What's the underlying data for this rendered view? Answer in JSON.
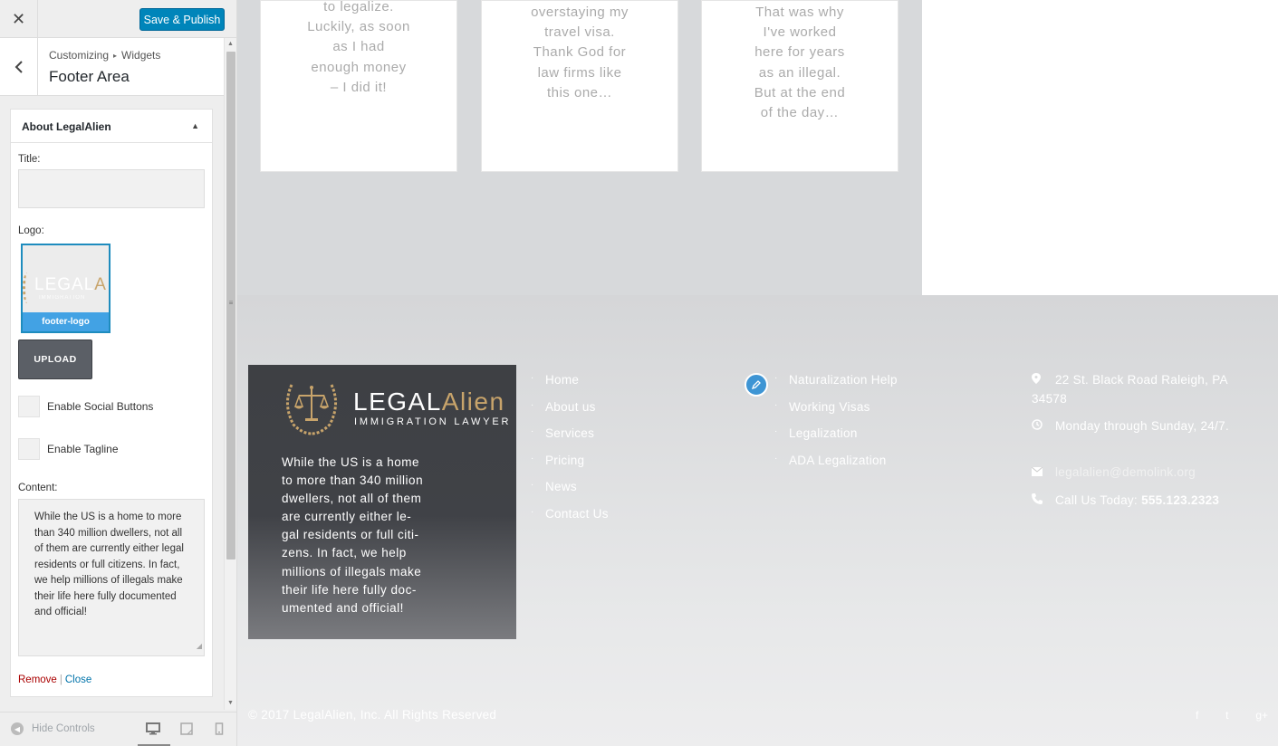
{
  "customizer": {
    "save_label": "Save & Publish",
    "breadcrumb": [
      "Customizing",
      "Widgets"
    ],
    "section_title": "Footer Area",
    "widget": {
      "title": "About LegalAlien",
      "title_label": "Title:",
      "title_value": "",
      "logo_label": "Logo:",
      "logo_thumb_brand_main": "LEGAL",
      "logo_thumb_brand_accent": "A",
      "logo_thumb_brand_sub": "IMMIGRATION",
      "logo_caption": "footer-logo",
      "upload_label": "UPLOAD",
      "social_label": "Enable Social Buttons",
      "tagline_label": "Enable Tagline",
      "content_label": "Content:",
      "content_value": "While the US is a home to more than 340 million dwellers, not all of them are currently either legal residents or full citizens. In fact, we help millions of illegals make their life here fully documented and official!",
      "remove_label": "Remove",
      "close_label": "Close",
      "separator": "|"
    },
    "hide_controls_label": "Hide Controls"
  },
  "preview": {
    "testimonial_cards": [
      {
        "lines": [
          "to legalize.",
          "Luckily, as soon",
          "as I had",
          "enough money",
          "– I did it!"
        ]
      },
      {
        "lines": [
          "overstaying my",
          "travel visa.",
          "Thank God for",
          "law firms like",
          "this one…"
        ]
      },
      {
        "lines": [
          "That was why",
          "I've worked",
          "here for years",
          "as an illegal.",
          "But at the end",
          "of the day…"
        ]
      }
    ],
    "footer_logo": {
      "main": "LEGAL",
      "accent": "Alien",
      "sub": "IMMIGRATION LAWYER"
    },
    "about_lines": [
      "While the US is a home",
      "to more than 340 million",
      "dwellers, not all of them",
      "are currently either le-",
      "gal residents or full citi-",
      "zens. In fact, we help",
      "millions of illegals make",
      "their life here fully doc-",
      "umented and official!"
    ],
    "menu_bullet": "·",
    "menu1": [
      "Home",
      "About us",
      "Services",
      "Pricing",
      "News",
      "Contact Us"
    ],
    "menu2": [
      "Naturalization Help",
      "Working Visas",
      "Legalization",
      "ADA Legalization"
    ],
    "contact": {
      "address": "22 St. Black Road Raleigh, PA 34578",
      "hours": "Monday through Sunday, 24/7.",
      "email": "legalalien@demolink.org",
      "phone_label": "Call Us Today:",
      "phone_number": "555.123.2323"
    },
    "copyright": "© 2017 LegalAlien, Inc. All Rights Reserved",
    "social": [
      "f",
      "t",
      "g+"
    ]
  }
}
